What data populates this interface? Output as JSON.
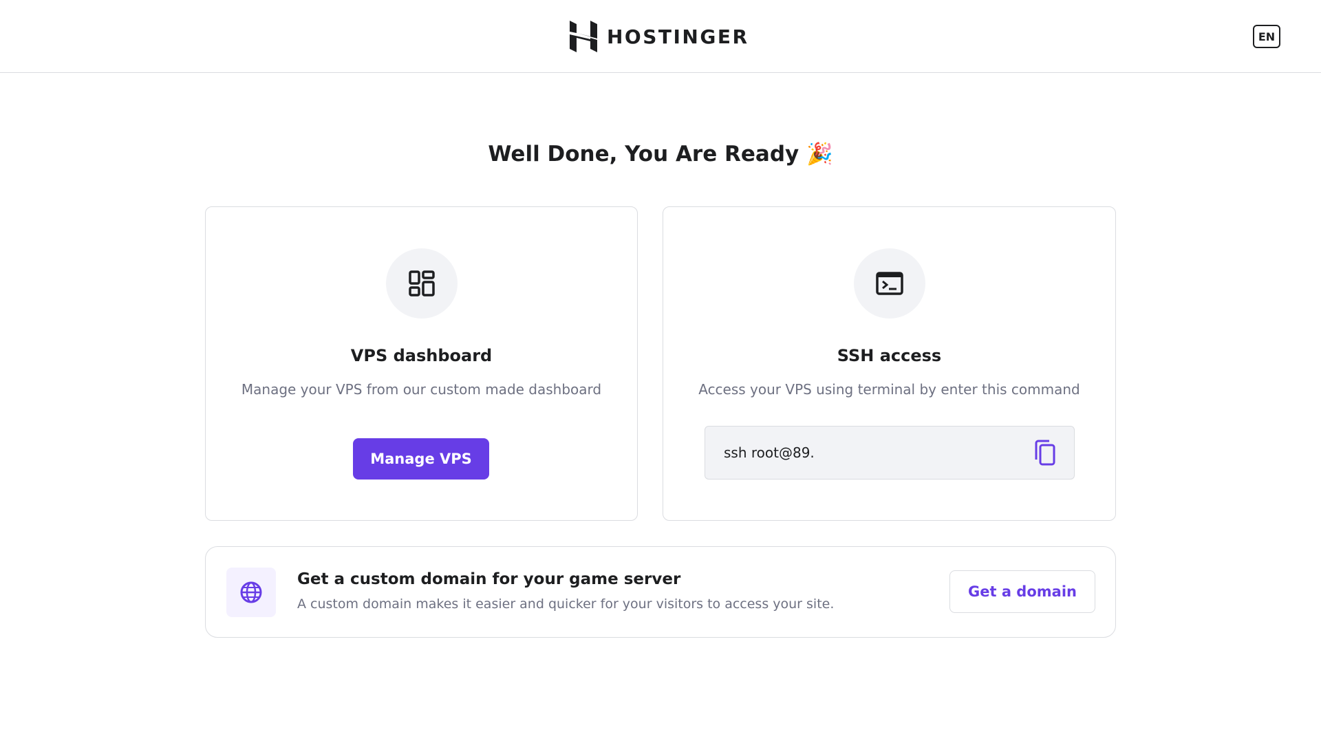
{
  "header": {
    "brand": "HOSTINGER",
    "language": "EN"
  },
  "page": {
    "heading": "Well Done, You Are Ready 🎉"
  },
  "cards": {
    "vps": {
      "icon": "dashboard-icon",
      "title": "VPS dashboard",
      "description": "Manage your VPS from our custom made dashboard",
      "button_label": "Manage VPS"
    },
    "ssh": {
      "icon": "terminal-icon",
      "title": "SSH access",
      "description": "Access your VPS using terminal by enter this command",
      "command": "ssh root@89.",
      "copy_icon": "copy-icon"
    }
  },
  "promo": {
    "icon": "globe-icon",
    "title": "Get a custom domain for your game server",
    "description": "A custom domain makes it easier and quicker for your visitors to access your site.",
    "button_label": "Get a domain"
  },
  "colors": {
    "accent": "#673de6",
    "text": "#1d1e20",
    "muted": "#6d7081",
    "border": "#dadce0",
    "icon_bg": "#f2f3f6"
  }
}
